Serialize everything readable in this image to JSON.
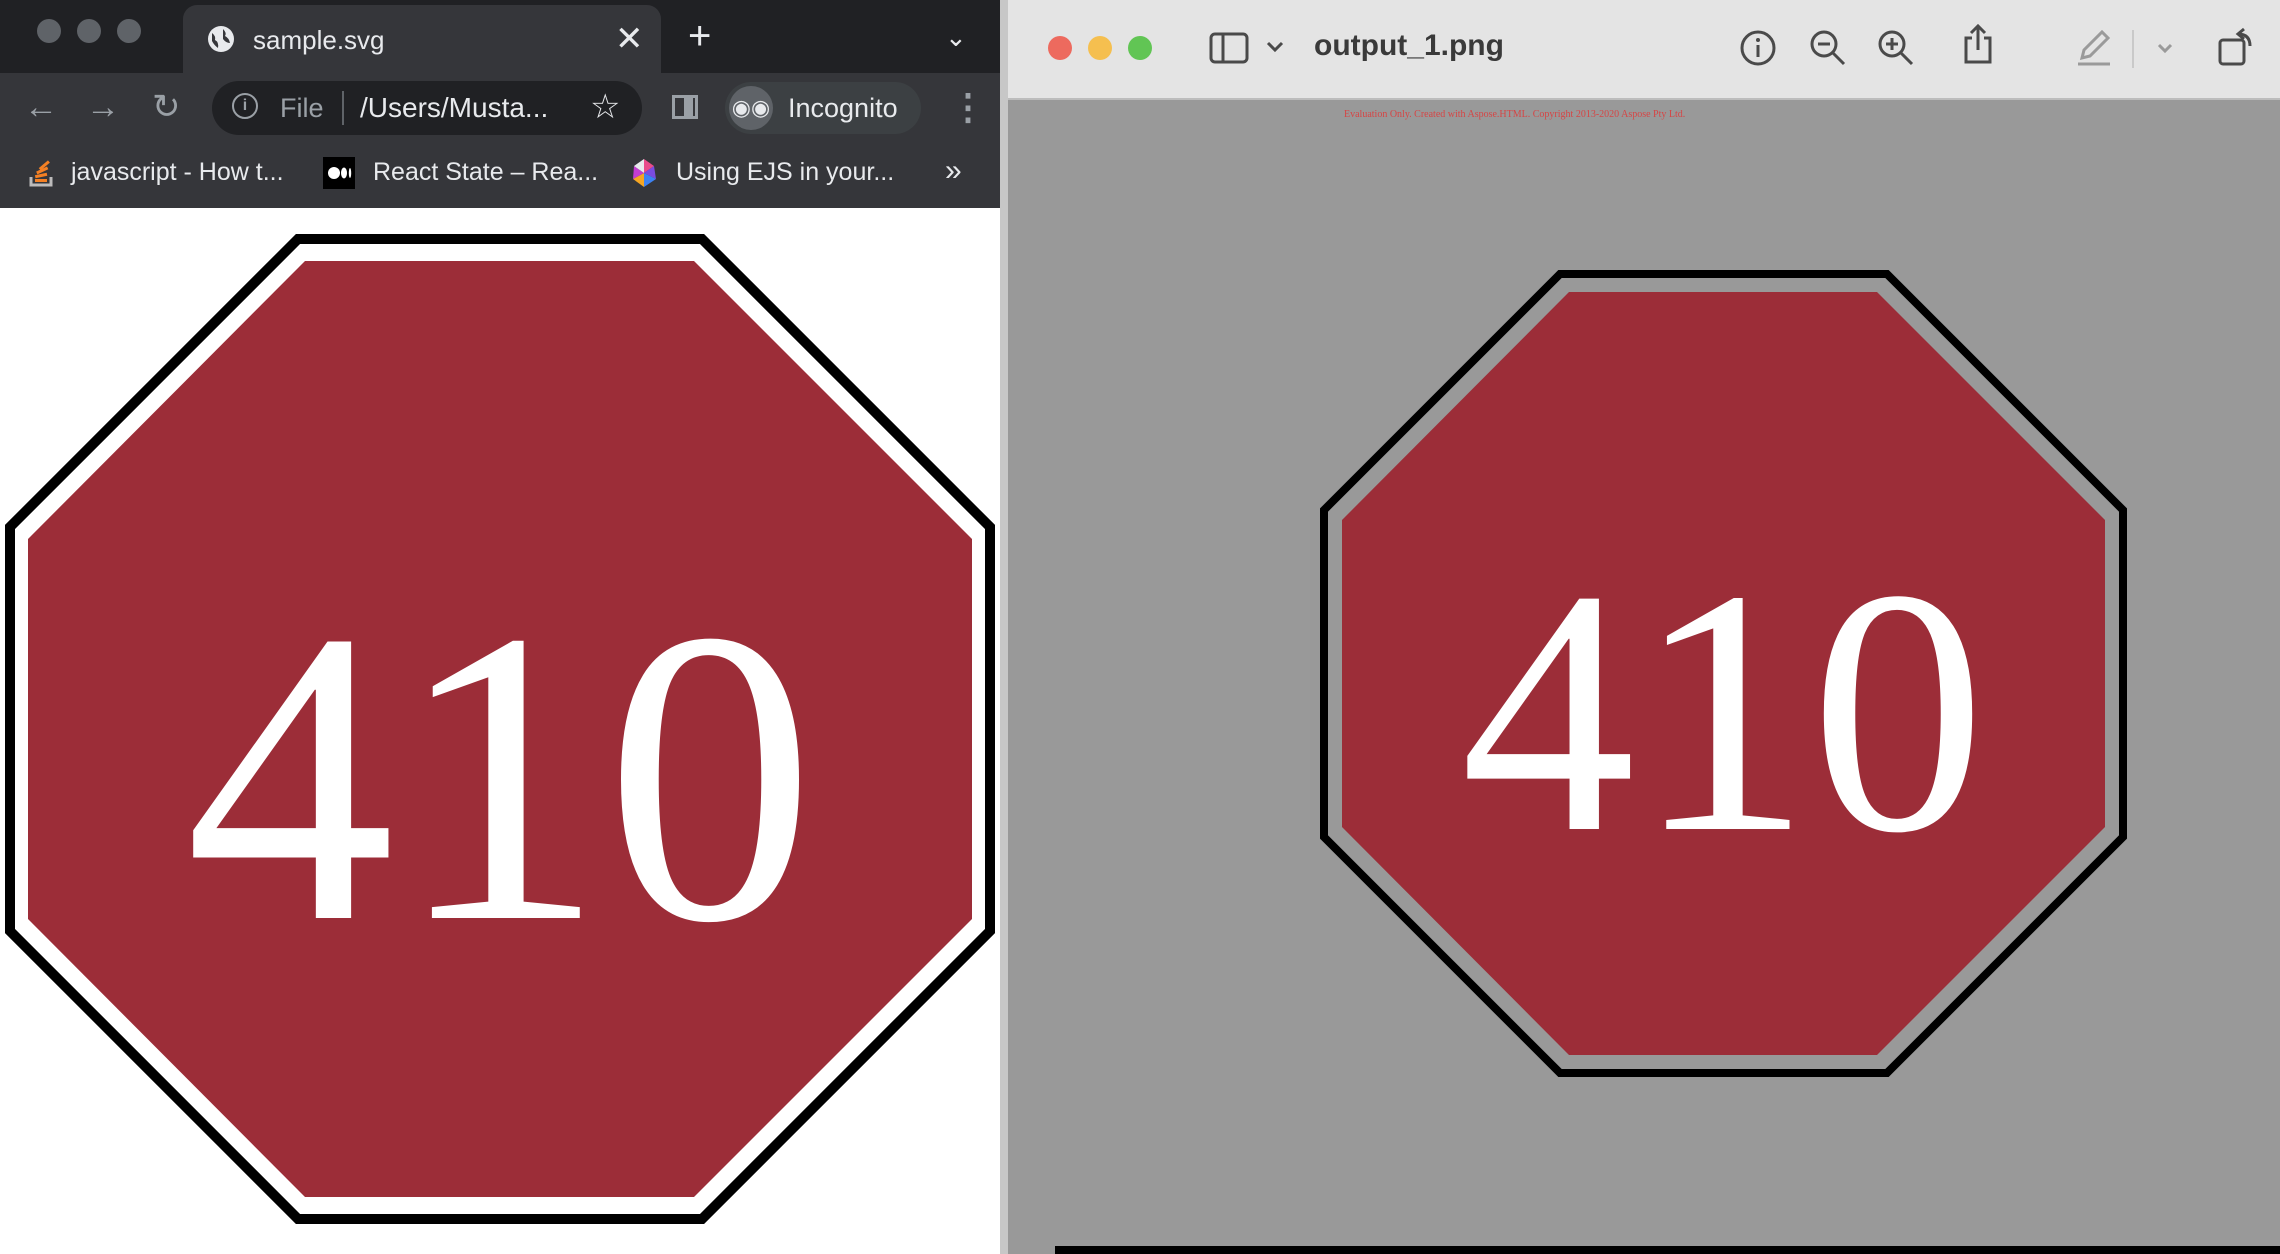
{
  "chrome": {
    "tab_title": "sample.svg",
    "tab_close": "✕",
    "new_tab": "+",
    "tab_search": "⌄",
    "back": "←",
    "forward": "→",
    "reload": "↻",
    "omnibox_scheme": "File",
    "omnibox_url": "/Users/Musta...",
    "star": "☆",
    "incognito_label": "Incognito",
    "menu": "⋮",
    "bookmarks": [
      {
        "label": "javascript - How t...",
        "icon": "stackoverflow-icon"
      },
      {
        "label": "React State – Rea...",
        "icon": "medium-icon"
      },
      {
        "label": "Using EJS in your...",
        "icon": "colorful-logo-icon"
      }
    ],
    "bookmarks_more": "»"
  },
  "sign_left": {
    "text": "410",
    "fill": "#9c2d38",
    "stroke": "#000000",
    "text_color": "#ffffff"
  },
  "preview": {
    "title": "output_1.png",
    "watermark": "Evaluation Only. Created with Aspose.HTML. Copyright 2013-2020 Aspose Pty Ltd.",
    "sign_text": "410",
    "sign_fill": "#9c2d38",
    "canvas_color": "#999999",
    "tools": [
      "info-icon",
      "zoom-out-icon",
      "zoom-in-icon",
      "share-icon",
      "markup-icon",
      "rotate-icon"
    ]
  }
}
